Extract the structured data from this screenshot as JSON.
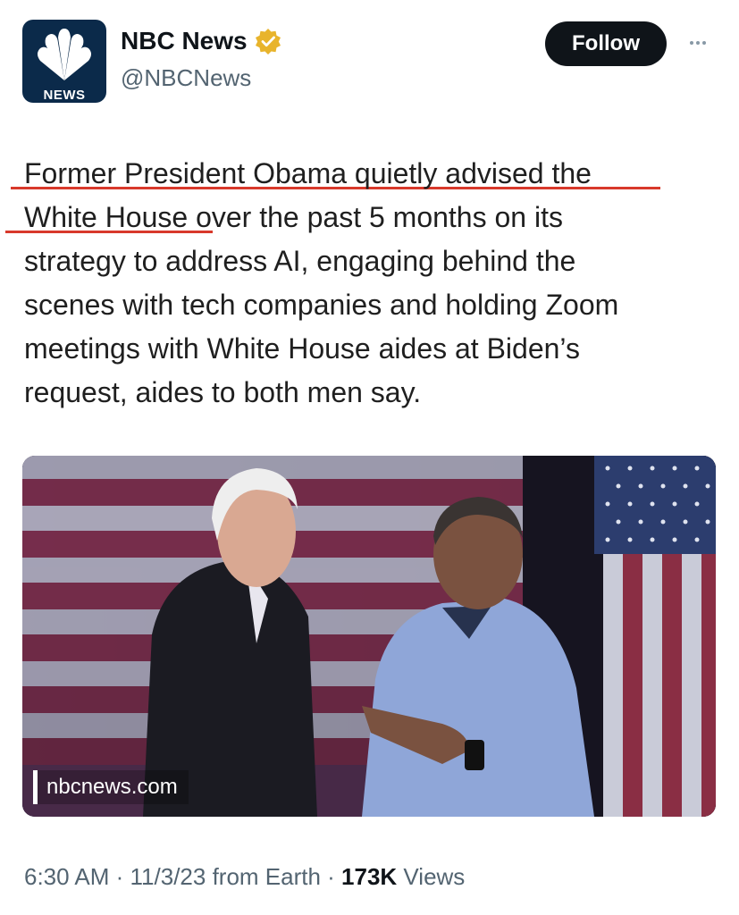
{
  "account": {
    "logo_label": "NEWS",
    "name": "NBC News",
    "handle": "@NBCNews",
    "verified_color": "#e8b42c"
  },
  "actions": {
    "follow_label": "Follow",
    "more_icon": "more-icon"
  },
  "tweet": {
    "lines": [
      "Former President Obama quietly advised the",
      "White House over the past 5 months on its",
      "strategy to address AI, engaging behind the",
      "scenes with tech companies and holding Zoom",
      "meetings with White House aides at Biden’s",
      "request, aides to both men say."
    ],
    "underline_color": "#d8392b"
  },
  "media": {
    "watermark": "nbcnews.com"
  },
  "meta": {
    "time": "6:30 AM",
    "sep1": " · ",
    "date": "11/3/23",
    "source": " from Earth",
    "sep2": " · ",
    "views_count": "173K",
    "views_label": " Views"
  }
}
